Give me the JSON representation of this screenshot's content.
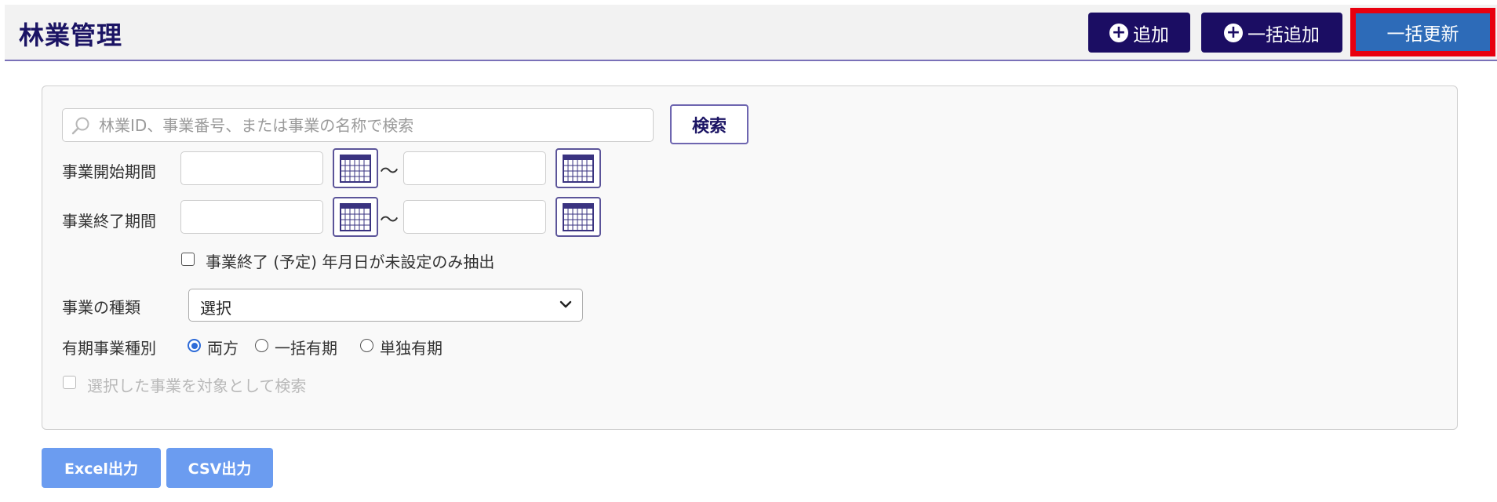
{
  "header": {
    "title": "林業管理",
    "add_label": "追加",
    "bulk_add_label": "一括追加",
    "bulk_update_label": "一括更新"
  },
  "search": {
    "placeholder": "林業ID、事業番号、または事業の名称で検索",
    "value": "",
    "button_label": "検索"
  },
  "filters": {
    "start_period_label": "事業開始期間",
    "end_period_label": "事業終了期間",
    "tilde": "〜",
    "unset_end_label": "事業終了 (予定) 年月日が未設定のみ抽出",
    "type_label": "事業の種類",
    "type_selected": "選択",
    "periodic_label": "有期事業種別",
    "periodic_options": [
      "両方",
      "一括有期",
      "単独有期"
    ],
    "periodic_selected": "両方",
    "selected_only_label": "選択した事業を対象として検索"
  },
  "export": {
    "excel_label": "Excel出力",
    "csv_label": "CSV出力"
  },
  "colors": {
    "header_button": "#1b0d63",
    "bulk_update": "#2d6bb8",
    "highlight": "#e8000f",
    "export_button": "#6b9cf0",
    "title": "#1b1464"
  }
}
